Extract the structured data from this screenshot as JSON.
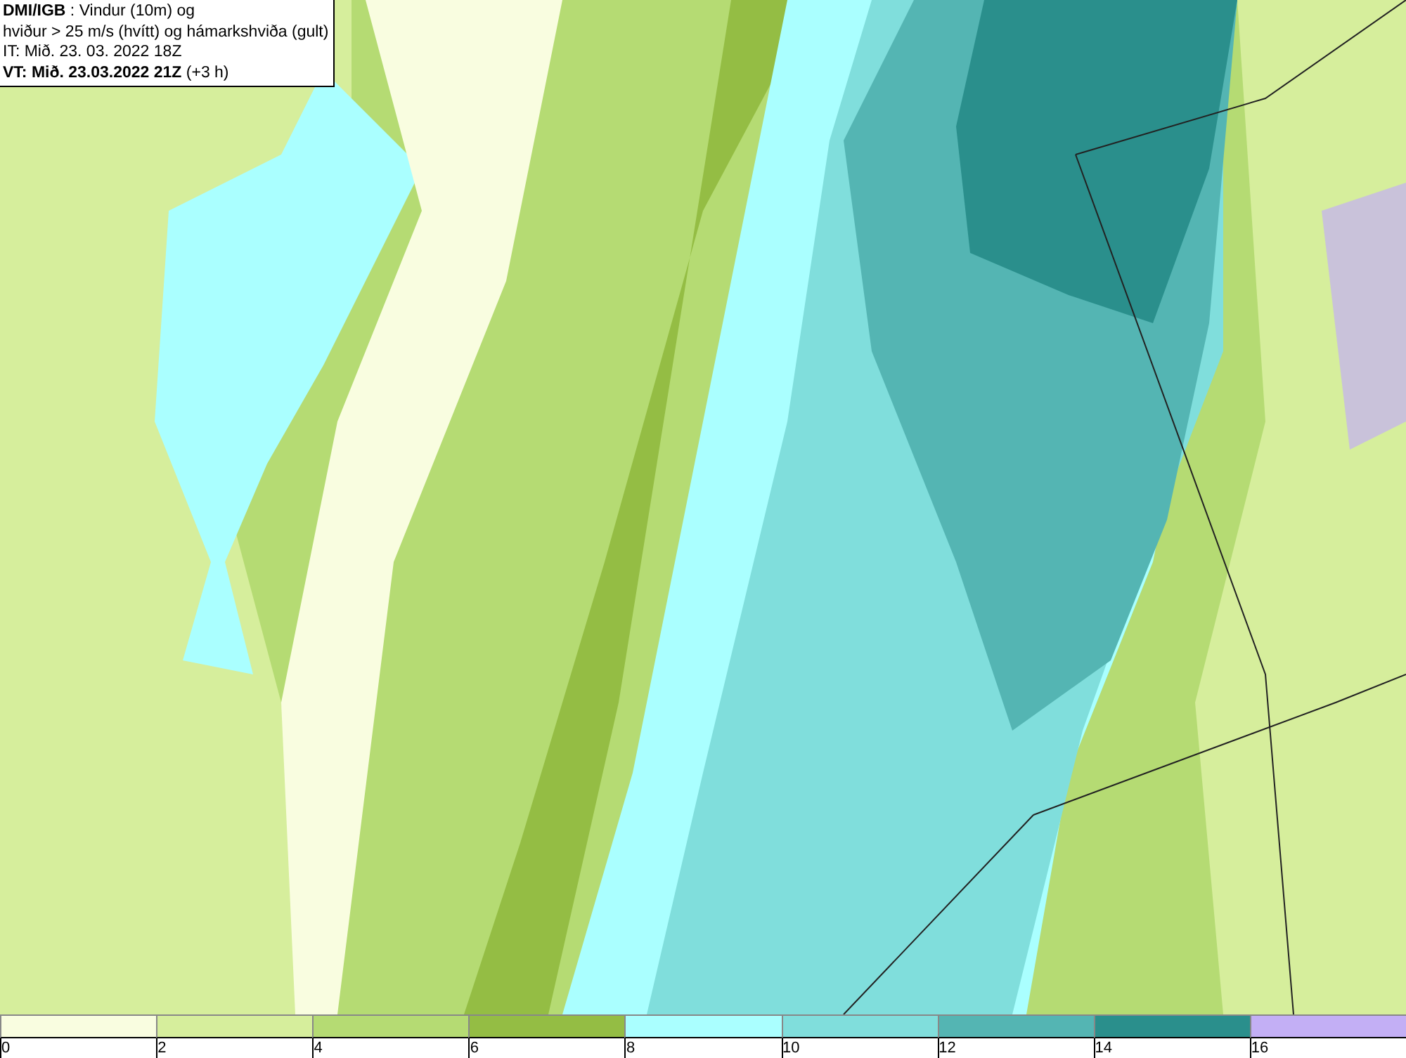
{
  "header": {
    "lines": [
      "**DMI/IGB** : Vindur (10m) og",
      "hviður > 25 m/s (hvítt) og hámarkshviða (gult)",
      "IT: Mið. 23. 03. 2022 18Z",
      "**VT: Mið. 23.03.2022 21Z** (+3 h)"
    ]
  },
  "legend": [
    {
      "label": "0",
      "color": "#f9fde0"
    },
    {
      "label": "2",
      "color": "#d6ee9c"
    },
    {
      "label": "4",
      "color": "#b5db73"
    },
    {
      "label": "6",
      "color": "#94bd44"
    },
    {
      "label": "8",
      "color": "#aaffff"
    },
    {
      "label": "10",
      "color": "#80dedc"
    },
    {
      "label": "12",
      "color": "#54b5b3"
    },
    {
      "label": "14",
      "color": "#2a8f8c"
    },
    {
      "label": "16",
      "color": "#c3aff5"
    }
  ]
}
